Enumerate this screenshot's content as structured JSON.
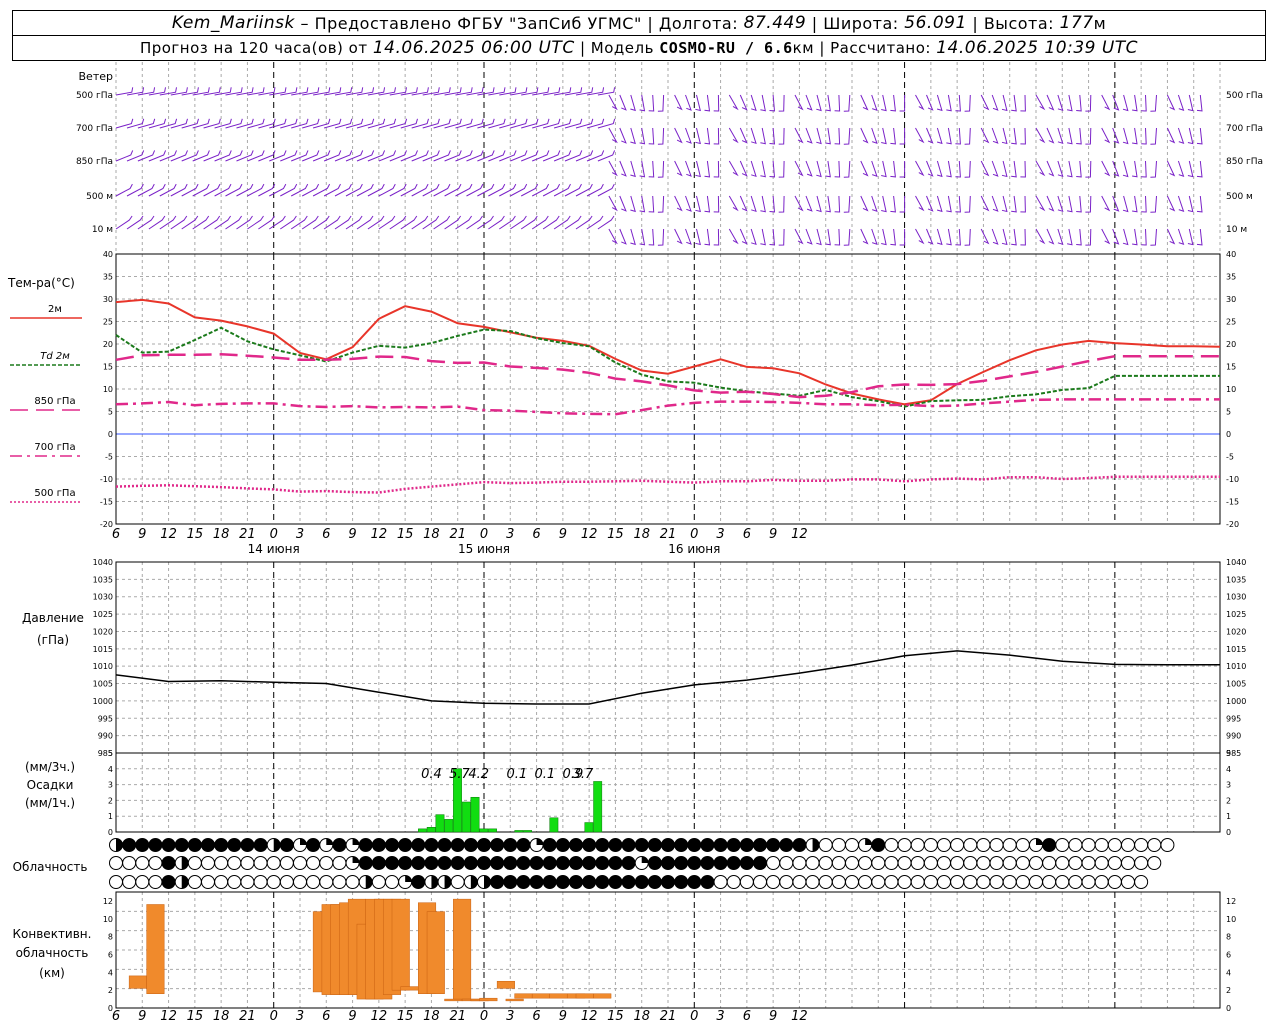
{
  "header": {
    "station": "Kem_Mariinsk",
    "provider": " – Предоставлено ФГБУ \"ЗапСиб УГМС\" | Долгота: ",
    "lon": "87.449",
    "lat_label": " | Широта: ",
    "lat": "56.091",
    "alt_label": " | Высота: ",
    "alt": "177",
    "alt_unit": "м",
    "forecast_label": "Прогноз на 120 часа(ов) от ",
    "forecast_from": "14.06.2025 06:00 UTC",
    "model_label": " | Модель ",
    "model": "COSMO-RU / 6.6",
    "model_unit": "км",
    "calc_label": " | Рассчитано: ",
    "calc_time": "14.06.2025 10:39 UTC"
  },
  "colors": {
    "t2m": "#e8352a",
    "td2m": "#1b7a1b",
    "t850": "#e0288a",
    "t700": "#e0288a",
    "t500": "#e0288a",
    "wind": "#7a22c8",
    "pressure": "#000000",
    "precip": "#11dd11",
    "conv": "#f08a2c",
    "zero_line": "#3050ff"
  },
  "time_axis": {
    "hour_ticks": [
      "6",
      "9",
      "12",
      "15",
      "18",
      "21",
      "0",
      "3",
      "6",
      "9",
      "12",
      "15",
      "18",
      "21",
      "0",
      "3",
      "6",
      "9",
      "12",
      "15",
      "18",
      "21",
      "0",
      "3",
      "6",
      "9",
      "12"
    ],
    "day_labels": [
      "14 июня",
      "15 июня",
      "16 июня"
    ]
  },
  "wind_panel": {
    "title": "Ветер",
    "levels": [
      "500 гПа",
      "700 гПа",
      "850 гПа",
      "500  м",
      "10   м"
    ]
  },
  "chart_data": [
    {
      "type": "line",
      "name": "temperature",
      "ylim": [
        -20,
        40
      ],
      "yticks": [
        "40",
        "35",
        "30",
        "25",
        "20",
        "15",
        "10",
        "5",
        "0",
        "-5",
        "-10",
        "-15",
        "-20"
      ],
      "legend_title": "Тем-ра(°С)",
      "x_hours": [
        0,
        3,
        6,
        9,
        12,
        15,
        18,
        21,
        24,
        27,
        30,
        33,
        36,
        39,
        42,
        45,
        48,
        51,
        54,
        57,
        60,
        63,
        66,
        69,
        72,
        75,
        78,
        81,
        84,
        87,
        90,
        93,
        96,
        99,
        102,
        105,
        108,
        111,
        114,
        117,
        120,
        123,
        126
      ],
      "series": [
        {
          "name": "2м",
          "values": [
            29.3,
            29.8,
            29,
            25.9,
            25.2,
            23.9,
            22.3,
            18,
            16.6,
            19.3,
            25.6,
            28.4,
            27.2,
            24.6,
            23.8,
            22.6,
            21.4,
            20.7,
            19.6,
            16.7,
            14.1,
            13.4,
            15,
            16.6,
            14.9,
            14.6,
            13.5,
            11,
            9,
            7.7,
            6.6,
            7.5,
            11.1,
            13.8,
            16.4,
            18.6,
            19.9,
            20.7,
            20.2,
            19.9,
            19.5,
            19.5,
            19.4
          ]
        },
        {
          "name": "Td 2м",
          "values": [
            22,
            18.1,
            18.3,
            20.9,
            23.6,
            20.6,
            18.8,
            17.5,
            16.1,
            18.1,
            19.6,
            19.2,
            20.2,
            21.8,
            23.2,
            22.9,
            21.3,
            20.2,
            19.5,
            15.9,
            13.2,
            11.7,
            11.4,
            10.3,
            9.5,
            9,
            8.5,
            9.8,
            8.2,
            7.3,
            6.1,
            7.3,
            7.5,
            7.6,
            8.4,
            8.8,
            9.8,
            10.2,
            12.9,
            12.9,
            12.9,
            12.9,
            12.9
          ]
        },
        {
          "name": "850 гПа",
          "values": [
            16.5,
            17.5,
            17.6,
            17.6,
            17.7,
            17.4,
            17,
            16.5,
            16.5,
            16.7,
            17.2,
            17.1,
            16.2,
            15.8,
            15.9,
            15,
            14.7,
            14.3,
            13.6,
            12.3,
            11.7,
            10.8,
            9.7,
            9.2,
            9.4,
            8.9,
            8.2,
            8.5,
            9.3,
            10.6,
            11,
            10.9,
            11.1,
            11.8,
            12.8,
            13.8,
            15,
            16.2,
            17.3,
            17.3,
            17.3,
            17.3,
            17.3
          ]
        },
        {
          "name": "700 гПа",
          "values": [
            6.6,
            6.8,
            7.1,
            6.4,
            6.7,
            6.8,
            6.8,
            6.2,
            6,
            6.2,
            5.9,
            6,
            5.9,
            6.1,
            5.3,
            5.2,
            4.9,
            4.6,
            4.5,
            4.4,
            5.3,
            6.3,
            6.9,
            7.2,
            7.2,
            7.1,
            6.9,
            6.6,
            6.6,
            6.4,
            6.5,
            6.2,
            6.3,
            6.8,
            7.2,
            7.6,
            7.7,
            7.7,
            7.7,
            7.7,
            7.7,
            7.7,
            7.7
          ]
        },
        {
          "name": "500 гПа",
          "values": [
            -11.7,
            -11.5,
            -11.4,
            -11.6,
            -11.8,
            -12.1,
            -12.3,
            -12.8,
            -12.7,
            -12.9,
            -13,
            -12.2,
            -11.7,
            -11.2,
            -10.7,
            -10.9,
            -10.8,
            -10.6,
            -10.6,
            -10.5,
            -10.4,
            -10.6,
            -10.8,
            -10.5,
            -10.5,
            -10.2,
            -10.4,
            -10.4,
            -10.1,
            -10.1,
            -10.5,
            -10.1,
            -9.9,
            -10.1,
            -9.6,
            -9.6,
            -10,
            -9.8,
            -9.5,
            -9.5,
            -9.5,
            -9.5,
            -9.5
          ]
        }
      ]
    },
    {
      "type": "line",
      "name": "pressure",
      "title": "Давление",
      "ylabel": "(гПа)",
      "ylim": [
        985,
        1040
      ],
      "yticks": [
        "1040",
        "1035",
        "1030",
        "1025",
        "1020",
        "1015",
        "1010",
        "1005",
        "1000",
        "995",
        "990",
        "985"
      ],
      "x_hours": [
        0,
        6,
        12,
        18,
        24,
        30,
        36,
        42,
        48,
        54,
        60,
        66,
        72,
        78,
        84,
        90,
        96,
        102,
        108,
        114,
        120,
        126
      ],
      "series": [
        {
          "name": "",
          "values": [
            1007.5,
            1005.6,
            1005.8,
            1005.4,
            1005,
            1002.5,
            1000,
            999.3,
            999.1,
            999.1,
            1002.2,
            1004.6,
            1006,
            1008,
            1010.3,
            1013,
            1014.4,
            1013.2,
            1011.4,
            1010.5,
            1010.4,
            1010.4
          ]
        }
      ]
    },
    {
      "type": "bar",
      "name": "precipitation",
      "ylabel": "(мм/3ч.) Осадки (мм/1ч.)",
      "ylim": [
        0,
        5
      ],
      "yticks": [
        "5",
        "4",
        "3",
        "2",
        "1",
        "0"
      ],
      "totals": [
        "0.4",
        "5.7",
        "4.2",
        "0.1",
        "0.1",
        "0.9",
        "3.7"
      ],
      "bars": [
        {
          "hour": 35,
          "value": 0.2
        },
        {
          "hour": 36,
          "value": 0.3
        },
        {
          "hour": 37,
          "value": 1.1
        },
        {
          "hour": 38,
          "value": 0.8
        },
        {
          "hour": 39,
          "value": 4.0
        },
        {
          "hour": 40,
          "value": 1.9
        },
        {
          "hour": 41,
          "value": 2.2
        },
        {
          "hour": 42,
          "value": 0.2
        },
        {
          "hour": 43,
          "value": 0.2
        },
        {
          "hour": 46,
          "value": 0.1
        },
        {
          "hour": 47,
          "value": 0.1
        },
        {
          "hour": 50,
          "value": 0.9
        },
        {
          "hour": 54,
          "value": 0.6
        },
        {
          "hour": 55,
          "value": 3.2
        }
      ]
    },
    {
      "type": "bar",
      "name": "convective cloud",
      "title": "Конвективн. облачность",
      "ylabel": "(км)",
      "ylim": [
        0,
        13
      ],
      "yticks": [
        "12",
        "10",
        "8",
        "6",
        "4",
        "2",
        "0"
      ],
      "bars": [
        {
          "hour": 2,
          "bottom": 2.2,
          "top": 3.6
        },
        {
          "hour": 4,
          "bottom": 1.6,
          "top": 11.6
        },
        {
          "hour": 23,
          "bottom": 1.8,
          "top": 10.8
        },
        {
          "hour": 24,
          "bottom": 1.5,
          "top": 11.6
        },
        {
          "hour": 25,
          "bottom": 1.5,
          "top": 11.6
        },
        {
          "hour": 26,
          "bottom": 1.5,
          "top": 11.8
        },
        {
          "hour": 27,
          "bottom": 1.5,
          "top": 12.2
        },
        {
          "hour": 28,
          "bottom": 1.0,
          "top": 9.4
        },
        {
          "hour": 29,
          "bottom": 1.0,
          "top": 12.2
        },
        {
          "hour": 30,
          "bottom": 1.0,
          "top": 12.2
        },
        {
          "hour": 31,
          "bottom": 1.5,
          "top": 12.2
        },
        {
          "hour": 32,
          "bottom": 2.0,
          "top": 12.2
        },
        {
          "hour": 33,
          "bottom": 2.0,
          "top": 2.4
        },
        {
          "hour": 35,
          "bottom": 1.6,
          "top": 11.8
        },
        {
          "hour": 36,
          "bottom": 1.6,
          "top": 10.8
        },
        {
          "hour": 38,
          "bottom": 0.8,
          "top": 1.0
        },
        {
          "hour": 39,
          "bottom": 1.0,
          "top": 12.2
        },
        {
          "hour": 40,
          "bottom": 0.8,
          "top": 1.0
        },
        {
          "hour": 41,
          "bottom": 0.8,
          "top": 1.0
        },
        {
          "hour": 42,
          "bottom": 0.8,
          "top": 1.1
        },
        {
          "hour": 44,
          "bottom": 2.2,
          "top": 3.0
        },
        {
          "hour": 45,
          "bottom": 0.8,
          "top": 1.0
        },
        {
          "hour": 46,
          "bottom": 1.1,
          "top": 1.6
        },
        {
          "hour": 48,
          "bottom": 1.1,
          "top": 1.6
        },
        {
          "hour": 50,
          "bottom": 1.1,
          "top": 1.6
        },
        {
          "hour": 52,
          "bottom": 1.1,
          "top": 1.6
        },
        {
          "hour": 53,
          "bottom": 1.1,
          "top": 1.6
        },
        {
          "hour": 55,
          "bottom": 1.1,
          "top": 1.6
        }
      ]
    }
  ],
  "cloud_panel": {
    "title": "Облачность",
    "rows": [
      "vhhhhhhhhhhhvhqhqhqhhhhhhhhhhhhhqhhhhhhhhhhhhhhhhhhhhvoooqhoooooooooooqhooooooooo",
      "ooooheooooooooooooqhhhhhhhhhhhhhhhhhhhhhqhhhhhhhhhoooooooooooooooooooooooooooooo",
      "ooooheoooooooooooooeooqheeoeehhhhhhhhhhhhhhhhhooooooooooooooooooooooooooooooooo"
    ]
  }
}
